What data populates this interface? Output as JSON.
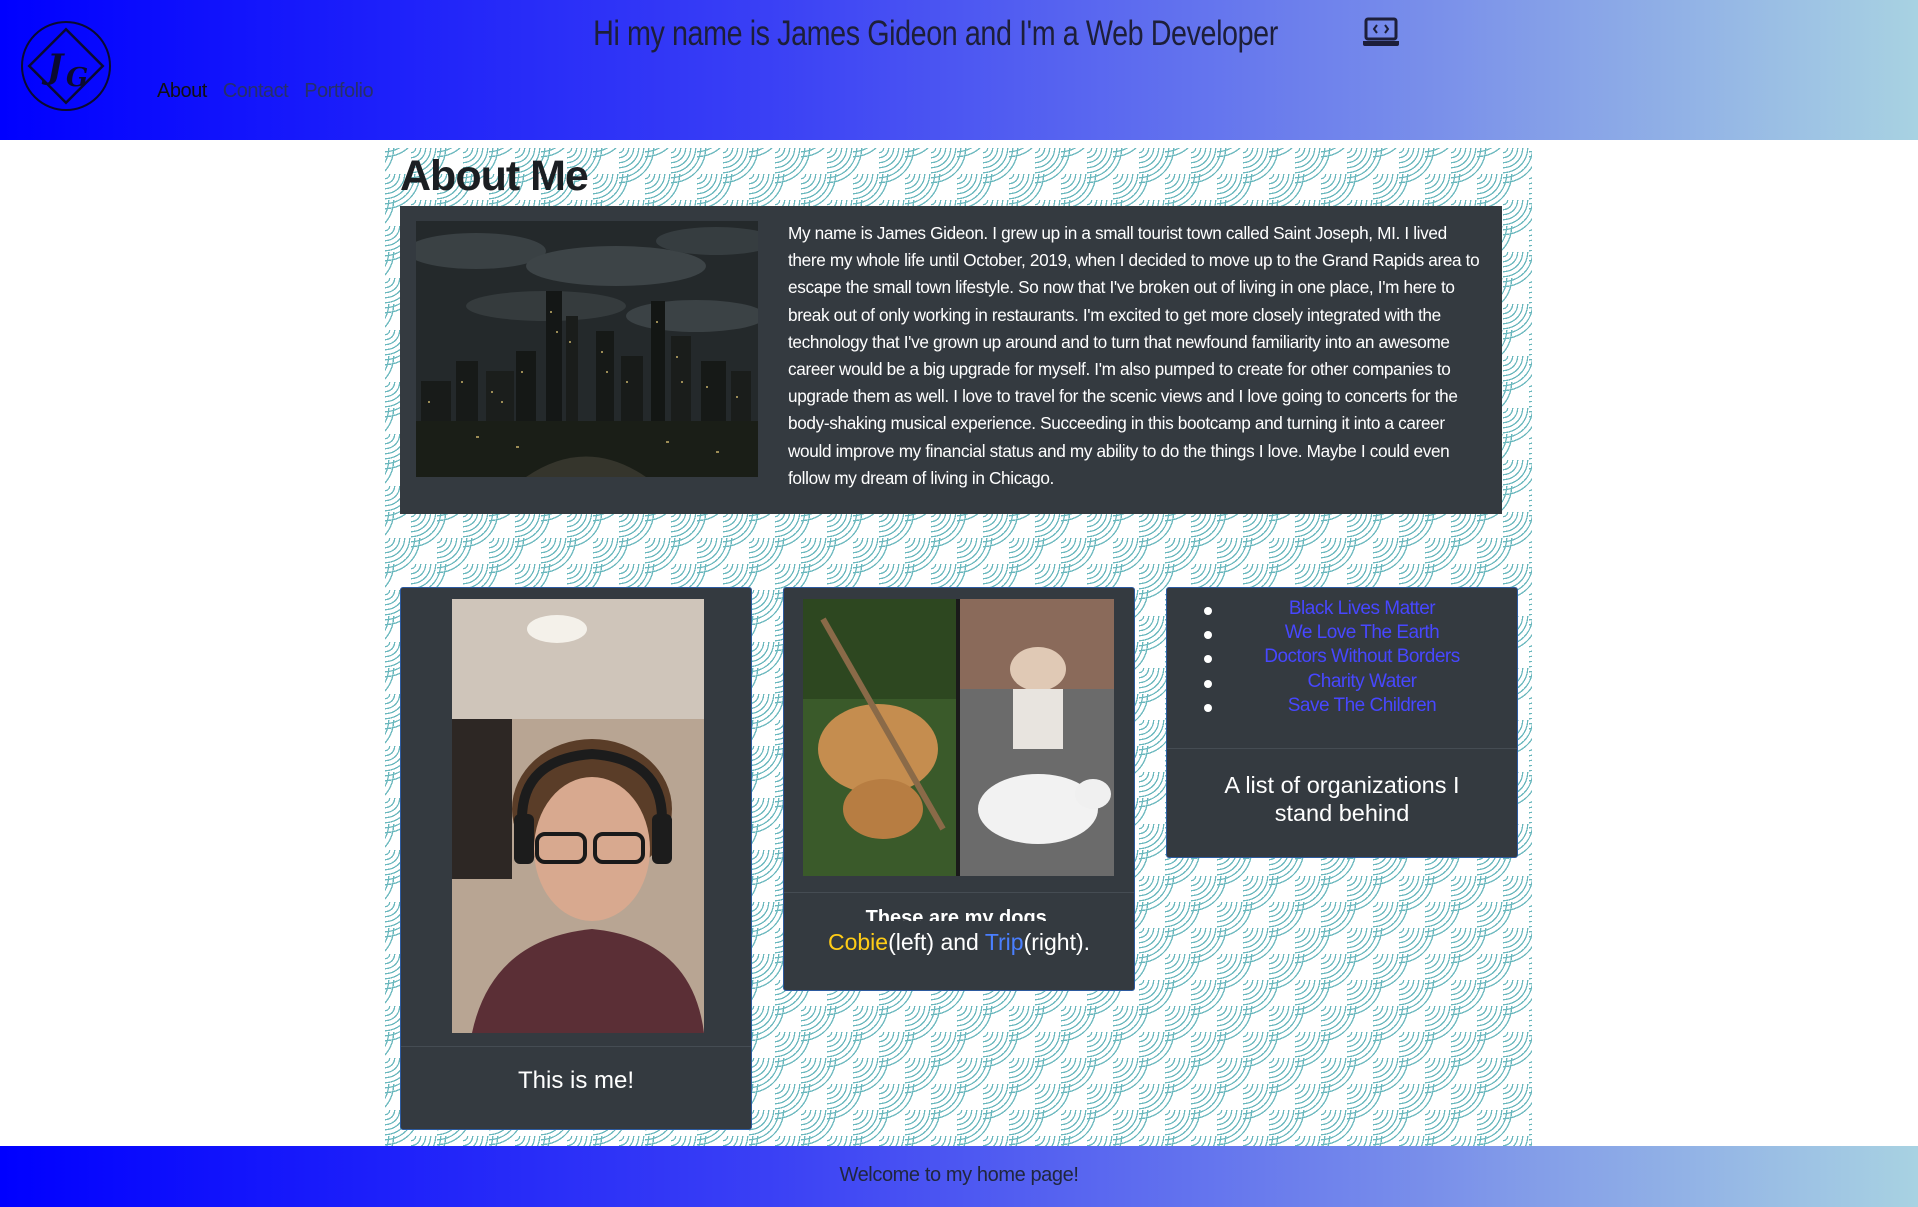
{
  "header": {
    "logo_text": "JG",
    "title": "Hi my name is James Gideon and I'm a Web Developer",
    "title_icon": "laptop-code-icon",
    "nav": [
      {
        "label": "About",
        "active": true
      },
      {
        "label": "Contact",
        "active": false
      },
      {
        "label": "Portfolio",
        "active": false
      }
    ]
  },
  "about": {
    "heading": "About Me",
    "image": "chicago-skyline-night",
    "text": "My name is James Gideon. I grew up in a small tourist town called Saint Joseph, MI. I lived there my whole life until October, 2019, when I decided to move up to the Grand Rapids area to escape the small town lifestyle. So now that I've broken out of living in one place, I'm here to break out of only working in restaurants. I'm excited to get more closely integrated with the technology that I've grown up around and to turn that newfound familiarity into an awesome career would be a big upgrade for myself. I'm also pumped to create for other companies to upgrade them as well. I love to travel for the scenic views and I love going to concerts for the body-shaking musical experience. Succeeding in this bootcamp and turning it into a career would improve my financial status and my ability to do the things I love. Maybe I could even follow my dream of living in Chicago."
  },
  "cards": {
    "me": {
      "caption": "This is me!"
    },
    "dogs": {
      "caption_line1": "These are my dogs,",
      "cobie": "Cobie",
      "left": "(left) and ",
      "trip": "Trip",
      "right": "(right)."
    },
    "orgs": {
      "items": [
        "Black Lives Matter",
        "We Love The Earth",
        "Doctors Without Borders",
        "Charity Water",
        "Save The Children"
      ],
      "caption": "A list of organizations I stand behind"
    }
  },
  "footer": {
    "text": "Welcome to my home page!"
  },
  "colors": {
    "header_gradient_start": "#0000ff",
    "header_gradient_end": "#a8d2e2",
    "panel_bg": "#343a40",
    "link": "#4747ff",
    "cobie": "#ffcc16",
    "trip": "#4a7fff"
  }
}
